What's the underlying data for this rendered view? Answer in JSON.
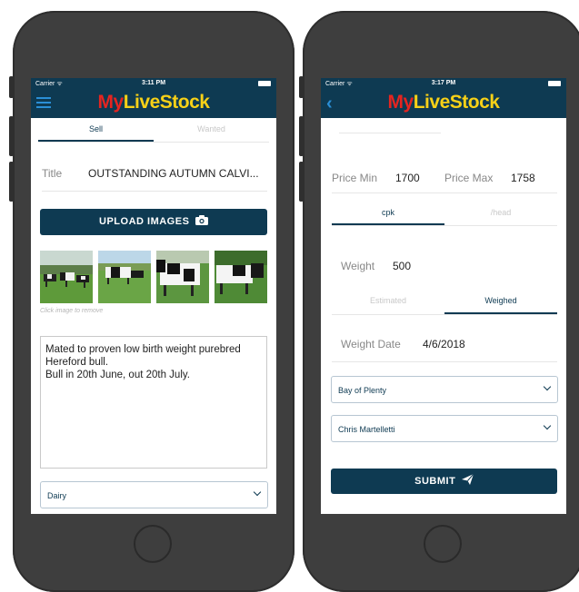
{
  "left_screen": {
    "status": {
      "carrier": "Carrier ᯤ",
      "time": "3:11 PM"
    },
    "brand": {
      "my": "My",
      "rest": "LiveStock"
    },
    "tabs": [
      {
        "label": "Sell"
      },
      {
        "label": "Wanted"
      }
    ],
    "title_label": "Title",
    "title_value": "OUTSTANDING AUTUMN CALVI...",
    "upload_label": "UPLOAD IMAGES",
    "image_hint": "Click image to remove",
    "description": "Mated to proven low birth weight purebred\nHereford bull.\nBull in 20th June, out 20th July.",
    "category": "Dairy"
  },
  "right_screen": {
    "status": {
      "carrier": "Carrier ᯤ",
      "time": "3:17 PM"
    },
    "brand": {
      "my": "My",
      "rest": "LiveStock"
    },
    "price_min_label": "Price Min",
    "price_min_value": "1700",
    "price_max_label": "Price Max",
    "price_max_value": "1758",
    "price_tabs": [
      {
        "label": "cpk"
      },
      {
        "label": "/head"
      }
    ],
    "weight_label": "Weight",
    "weight_value": "500",
    "weight_tabs": [
      {
        "label": "Estimated"
      },
      {
        "label": "Weighed"
      }
    ],
    "weight_date_label": "Weight Date",
    "weight_date_value": "4/6/2018",
    "region": "Bay of Plenty",
    "agent": "Chris Martelletti",
    "submit_label": "SUBMIT"
  }
}
